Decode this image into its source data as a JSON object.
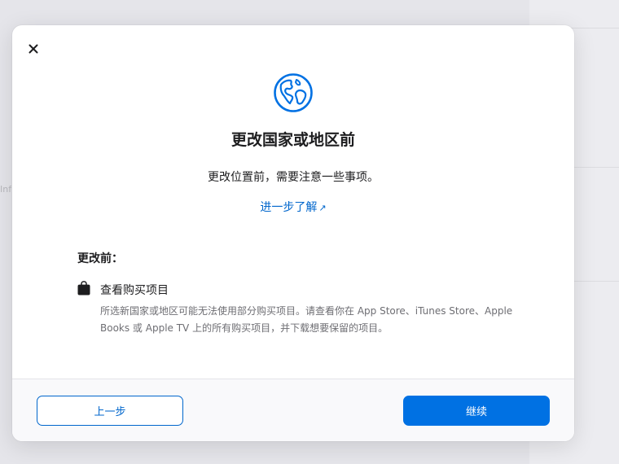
{
  "background": {
    "fragment_text": "Info"
  },
  "dialog": {
    "title": "更改国家或地区前",
    "subtitle": "更改位置前，需要注意一些事项。",
    "learn_more_label": "进一步了解",
    "learn_more_arrow": "↗",
    "section_label": "更改前：",
    "items": [
      {
        "icon": "shopping-bag-icon",
        "title": "查看购买项目",
        "description": "所选新国家或地区可能无法使用部分购买项目。请查看你在 App Store、iTunes Store、Apple Books 或 Apple TV 上的所有购买项目，并下载想要保留的项目。"
      }
    ],
    "buttons": {
      "back_label": "上一步",
      "continue_label": "继续"
    },
    "icons": {
      "close": "close-icon",
      "header": "globe-icon"
    }
  },
  "colors": {
    "accent": "#0071e3",
    "link": "#0066cc",
    "text_primary": "#1d1d1f",
    "text_secondary": "#6e6e73",
    "footer_background": "#f9f9fb",
    "backdrop": "#e5e5ea"
  }
}
